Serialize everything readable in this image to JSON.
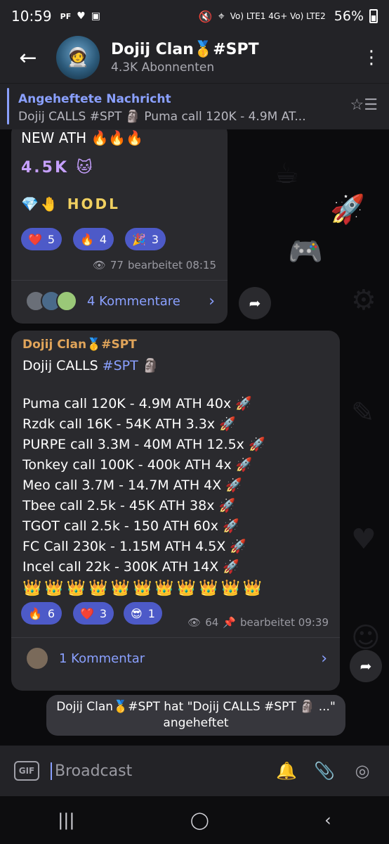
{
  "status_bar": {
    "time": "10:59",
    "left_icons": [
      "PF",
      "heart-icon",
      "image-icon"
    ],
    "network": "Vo) LTE1 4G+ Vo) LTE2",
    "battery": "56%"
  },
  "header": {
    "title": "Dojij Clan🥇#SPT",
    "subtitle": "4.3K Abonnenten"
  },
  "pinned": {
    "title": "Angeheftete Nachricht",
    "text": "Dojij CALLS #SPT 🗿 Puma call 120K - 4.9M AT..."
  },
  "message1": {
    "line1": "NEW ATH 🔥🔥🔥",
    "line2": "4.5K 🐱",
    "line3": "💎🤚 HODL",
    "reactions": [
      {
        "emoji": "❤️",
        "count": "5"
      },
      {
        "emoji": "🔥",
        "count": "4"
      },
      {
        "emoji": "🎉",
        "count": "3"
      }
    ],
    "views": "77",
    "edited": "bearbeitet 08:15",
    "comments_label": "4 Kommentare"
  },
  "message2": {
    "sender": "Dojij Clan🥇#SPT",
    "head_text": "Dojij CALLS ",
    "head_tag": "#SPT",
    "head_emoji": "🗿",
    "calls": [
      "Puma call 120K - 4.9M ATH 40x 🚀",
      "Rzdk call 16K - 54K ATH 3.3x 🚀",
      "PURPE call 3.3M - 40M ATH 12.5x 🚀",
      "Tonkey call 100K - 400k ATH 4x 🚀",
      "Meo call 3.7M - 14.7M ATH 4X 🚀",
      "Tbee call 2.5k - 45K ATH 38x 🚀",
      "TGOT call 2.5k - 150 ATH 60x 🚀",
      "FC Call 230k - 1.15M ATH 4.5X 🚀",
      "Incel call 22k - 300K ATH 14X 🚀"
    ],
    "crowns": "👑👑👑👑👑👑👑👑👑👑👑",
    "reactions": [
      {
        "emoji": "🔥",
        "count": "6"
      },
      {
        "emoji": "❤️",
        "count": "3"
      },
      {
        "emoji": "😎",
        "count": "1"
      }
    ],
    "views": "64",
    "edited": "bearbeitet 09:39",
    "comments_label": "1 Kommentar"
  },
  "service_message": "Dojij Clan🥇#SPT hat \"Dojij CALLS #SPT 🗿 ...\" angeheftet",
  "input_bar": {
    "gif_label": "GIF",
    "placeholder": "Broadcast"
  }
}
